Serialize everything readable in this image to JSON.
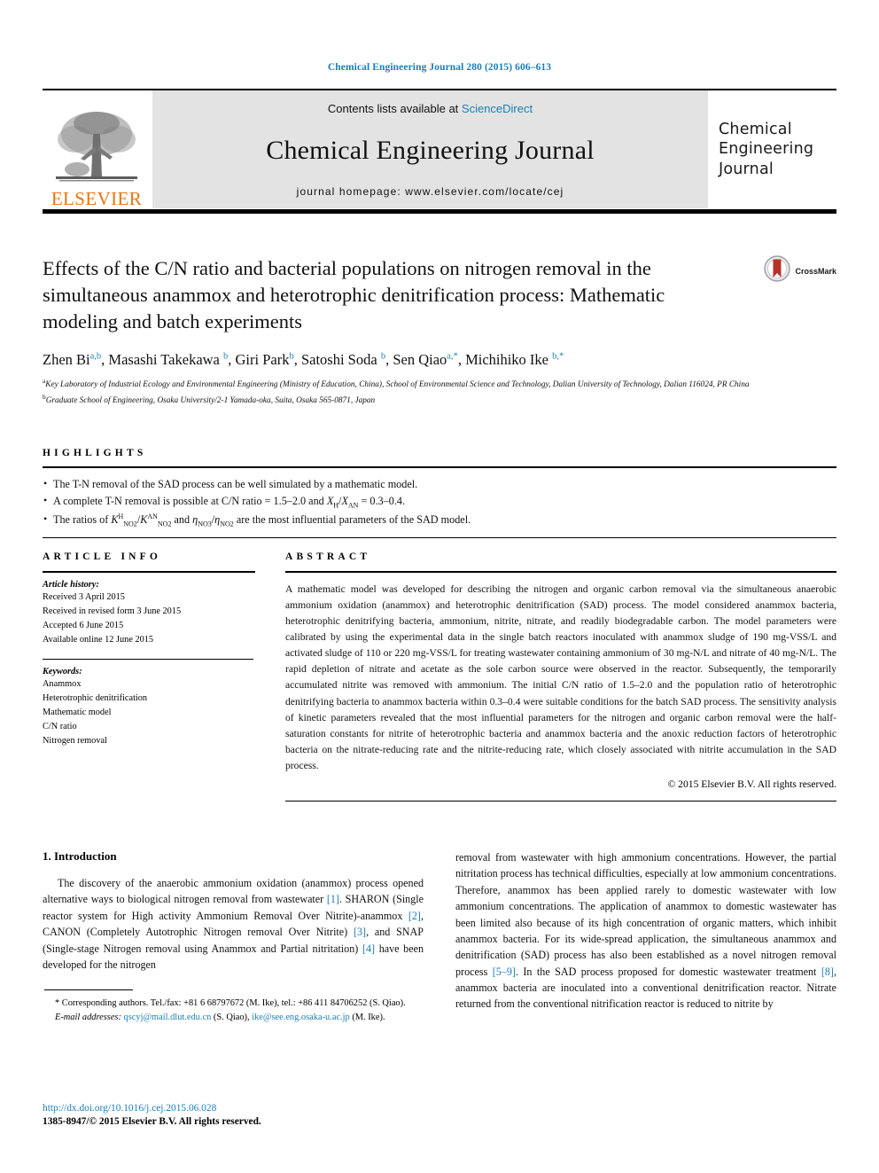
{
  "running_head": "Chemical Engineering Journal 280 (2015) 606–613",
  "masthead": {
    "contents_prefix": "Contents lists available at ",
    "contents_link": "ScienceDirect",
    "journal_title": "Chemical Engineering Journal",
    "homepage": "journal homepage: www.elsevier.com/locate/cej",
    "publisher_name": "ELSEVIER",
    "cej_logo_lines": [
      "Chemical",
      "Engineering",
      "Journal"
    ]
  },
  "article": {
    "title": "Effects of the C/N ratio and bacterial populations on nitrogen removal in the simultaneous anammox and heterotrophic denitrification process: Mathematic modeling and batch experiments",
    "crossmark_label": "CrossMark",
    "authors": [
      {
        "name": "Zhen Bi",
        "sup": "a,b"
      },
      {
        "name": "Masashi Takekawa",
        "sup": "b"
      },
      {
        "name": "Giri Park",
        "sup": "b"
      },
      {
        "name": "Satoshi Soda",
        "sup": "b"
      },
      {
        "name": "Sen Qiao",
        "sup": "a,*"
      },
      {
        "name": "Michihiko Ike",
        "sup": "b,*"
      }
    ],
    "affiliations": [
      {
        "label": "a",
        "text": "Key Laboratory of Industrial Ecology and Environmental Engineering (Ministry of Education, China), School of Environmental Science and Technology, Dalian University of Technology, Dalian 116024, PR China"
      },
      {
        "label": "b",
        "text": "Graduate School of Engineering, Osaka University/2-1 Yamada-oka, Suita, Osaka 565-0871, Japan"
      }
    ]
  },
  "highlights": {
    "heading": "HIGHLIGHTS",
    "items": [
      "The T-N removal of the SAD process can be well simulated by a mathematic model.",
      "A complete T-N removal is possible at C/N ratio = 1.5–2.0 and XH/XAN = 0.3–0.4.",
      "The ratios of KH NO2/KAN NO2 and ηNO3/ηNO2 are the most influential parameters of the SAD model."
    ]
  },
  "article_info": {
    "heading": "ARTICLE INFO",
    "history_label": "Article history:",
    "history": [
      "Received 3 April 2015",
      "Received in revised form 3 June 2015",
      "Accepted 6 June 2015",
      "Available online 12 June 2015"
    ],
    "keywords_label": "Keywords:",
    "keywords": [
      "Anammox",
      "Heterotrophic denitrification",
      "Mathematic model",
      "C/N ratio",
      "Nitrogen removal"
    ]
  },
  "abstract": {
    "heading": "ABSTRACT",
    "text": "A mathematic model was developed for describing the nitrogen and organic carbon removal via the simultaneous anaerobic ammonium oxidation (anammox) and heterotrophic denitrification (SAD) process. The model considered anammox bacteria, heterotrophic denitrifying bacteria, ammonium, nitrite, nitrate, and readily biodegradable carbon. The model parameters were calibrated by using the experimental data in the single batch reactors inoculated with anammox sludge of 190 mg-VSS/L and activated sludge of 110 or 220 mg-VSS/L for treating wastewater containing ammonium of 30 mg-N/L and nitrate of 40 mg-N/L. The rapid depletion of nitrate and acetate as the sole carbon source were observed in the reactor. Subsequently, the temporarily accumulated nitrite was removed with ammonium. The initial C/N ratio of 1.5–2.0 and the population ratio of heterotrophic denitrifying bacteria to anammox bacteria within 0.3–0.4 were suitable conditions for the batch SAD process. The sensitivity analysis of kinetic parameters revealed that the most influential parameters for the nitrogen and organic carbon removal were the half-saturation constants for nitrite of heterotrophic bacteria and anammox bacteria and the anoxic reduction factors of heterotrophic bacteria on the nitrate-reducing rate and the nitrite-reducing rate, which closely associated with nitrite accumulation in the SAD process.",
    "copyright": "© 2015 Elsevier B.V. All rights reserved."
  },
  "body": {
    "section_number_title": "1. Introduction",
    "left_para_1_a": "The discovery of the anaerobic ammonium oxidation (anammox) process opened alternative ways to biological nitrogen removal from wastewater ",
    "left_ref_1": "[1]",
    "left_para_1_b": ". SHARON (Single reactor system for High activity Ammonium Removal Over Nitrite)-anammox ",
    "left_ref_2": "[2]",
    "left_para_1_c": ", CANON (Completely Autotrophic Nitrogen removal Over Nitrite) ",
    "left_ref_3": "[3]",
    "left_para_1_d": ", and SNAP (Single-stage Nitrogen removal using Anammox and Partial nitritation) ",
    "left_ref_4": "[4]",
    "left_para_1_e": " have been developed for the nitrogen",
    "right_para_a": "removal from wastewater with high ammonium concentrations. However, the partial nitritation process has technical difficulties, especially at low ammonium concentrations. Therefore, anammox has been applied rarely to domestic wastewater with low ammonium concentrations. The application of anammox to domestic wastewater has been limited also because of its high concentration of organic matters, which inhibit anammox bacteria. For its wide-spread application, the simultaneous anammox and denitrification (SAD) process has also been established as a novel nitrogen removal process ",
    "right_ref_5_9": "[5–9]",
    "right_para_b": ". In the SAD process proposed for domestic wastewater treatment ",
    "right_ref_8": "[8]",
    "right_para_c": ", anammox bacteria are inoculated into a conventional denitrification reactor. Nitrate returned from the conventional nitrification reactor is reduced to nitrite by"
  },
  "footnote": {
    "corresponding": "* Corresponding authors. Tel./fax: +81 6 68797672 (M. Ike), tel.: +86 411 84706252 (S. Qiao).",
    "email_label": "E-mail addresses:",
    "email_1": "qscyj@mail.dlut.edu.cn",
    "email_1_owner": " (S. Qiao), ",
    "email_2": "ike@see.eng.osaka-u.ac.jp",
    "email_2_owner": " (M. Ike)."
  },
  "page_footer": {
    "doi": "http://dx.doi.org/10.1016/j.cej.2015.06.028",
    "issn": "1385-8947/© 2015 Elsevier B.V. All rights reserved."
  },
  "colors": {
    "link": "#1b7eb5",
    "elsevier_orange": "#e87511",
    "masthead_gray": "#e3e3e3",
    "crossmark_red": "#b5332a"
  }
}
